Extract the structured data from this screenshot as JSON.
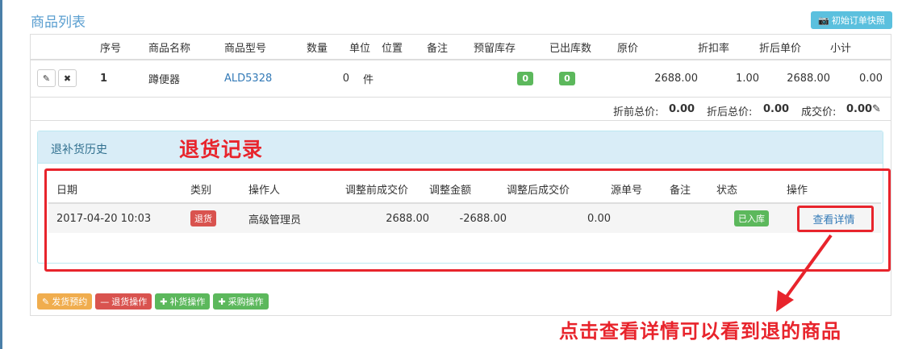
{
  "header": {
    "title": "商品列表",
    "snapshot_button": "初始订单快照"
  },
  "goods_table": {
    "columns": [
      "序号",
      "商品名称",
      "商品型号",
      "数量",
      "单位",
      "位置",
      "备注",
      "预留库存",
      "已出库数",
      "原价",
      "折扣率",
      "折后单价",
      "小计"
    ],
    "rows": [
      {
        "index": "1",
        "name": "蹲便器",
        "model": "ALD5328",
        "qty": "0",
        "unit": "件",
        "location": "",
        "note": "",
        "reserved": "0",
        "shipped": "0",
        "orig_price": "2688.00",
        "discount": "1.00",
        "disc_price": "2688.00",
        "subtotal": "0.00"
      }
    ]
  },
  "totals": {
    "before_label": "折前总价:",
    "before_value": "0.00",
    "after_label": "折后总价:",
    "after_value": "0.00",
    "deal_label": "成交价:",
    "deal_value": "0.00"
  },
  "history_panel": {
    "title": "退补货历史",
    "annotation": "退货记录",
    "columns": [
      "日期",
      "类别",
      "操作人",
      "调整前成交价",
      "调整金额",
      "调整后成交价",
      "源单号",
      "备注",
      "状态",
      "操作"
    ],
    "rows": [
      {
        "date": "2017-04-20 10:03",
        "type": "退货",
        "operator": "高级管理员",
        "before": "2688.00",
        "amount": "-2688.00",
        "after": "0.00",
        "source": "",
        "note": "",
        "status": "已入库",
        "action": "查看详情"
      }
    ]
  },
  "actions": {
    "reserve": "发货预约",
    "return": "退货操作",
    "replenish": "补货操作",
    "purchase": "采购操作"
  },
  "annotation_bottom": "点击查看详情可以看到退的商品",
  "colors": {
    "annotation_red": "#e8242c",
    "title_blue": "#5b9fd0",
    "panel_blue": "#d9edf7",
    "success_green": "#5cb85c",
    "danger_red": "#d9534f",
    "warning_orange": "#f0ad4e",
    "info_cyan": "#5bc0de"
  }
}
